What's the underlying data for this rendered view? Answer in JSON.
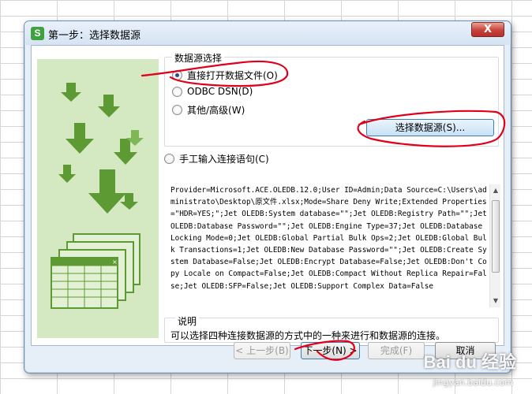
{
  "window": {
    "app_icon": "S",
    "title": "第一步：选择数据源",
    "close_label": "X"
  },
  "datasource": {
    "group_label": "数据源选择",
    "options": [
      {
        "label": "直接打开数据文件(O)",
        "checked": true
      },
      {
        "label": "ODBC DSN(D)",
        "checked": false
      },
      {
        "label": "其他/高级(W)",
        "checked": false
      }
    ],
    "select_button": "选择数据源(S)...",
    "manual_label": "手工输入连接语句(C)",
    "connection_text": "Provider=Microsoft.ACE.OLEDB.12.0;User ID=Admin;Data Source=C:\\Users\\administrato\\Desktop\\原文件.xlsx;Mode=Share Deny Write;Extended Properties=\"HDR=YES;\";Jet OLEDB:System database=\"\";Jet OLEDB:Registry Path=\"\";Jet OLEDB:Database Password=\"\";Jet OLEDB:Engine Type=37;Jet OLEDB:Database Locking Mode=0;Jet OLEDB:Global Partial Bulk Ops=2;Jet OLEDB:Global Bulk Transactions=1;Jet OLEDB:New Database Password=\"\";Jet OLEDB:Create System Database=False;Jet OLEDB:Encrypt Database=False;Jet OLEDB:Don't Copy Locale on Compact=False;Jet OLEDB:Compact Without Replica Repair=False;Jet OLEDB:SFP=False;Jet OLEDB:Support Complex Data=False"
  },
  "description": {
    "label": "说明",
    "text": "可以选择四种连接数据源的方式中的一种来进行和数据源的连接。"
  },
  "footer": {
    "prev": "< 上一步(B)",
    "next": "下一步(N) >",
    "finish": "完成(F)",
    "cancel": "取消"
  },
  "watermark": {
    "brand": "Bai du 经验",
    "url": "jingyan.baidu.com"
  },
  "colors": {
    "accent": "#3c7fb1",
    "illustration": "#5d9a34",
    "annotation": "#e0001b"
  }
}
